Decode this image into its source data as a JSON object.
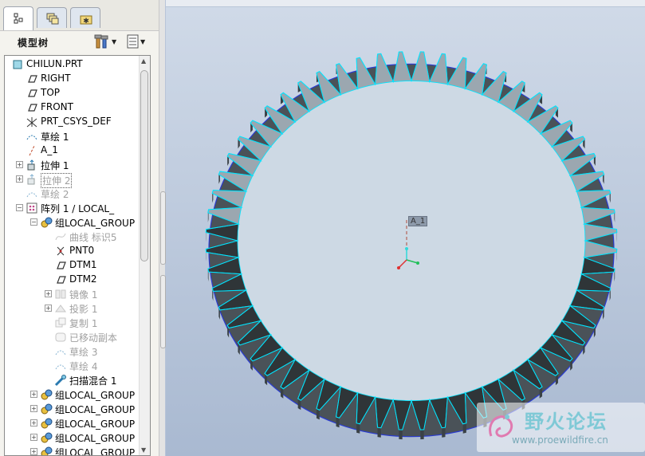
{
  "model_tree": {
    "title": "模型树",
    "tabs": [
      {
        "name": "model-tree-tab",
        "icon": "tree-icon",
        "active": true
      },
      {
        "name": "layers-tab",
        "icon": "layers-icon",
        "active": false
      },
      {
        "name": "favorites-tab",
        "icon": "folder-star-icon",
        "active": false
      }
    ],
    "toolbar": [
      {
        "name": "settings-button",
        "icon": "tools-icon"
      },
      {
        "name": "show-button",
        "icon": "list-icon"
      }
    ],
    "items": [
      {
        "label": "CHILUN.PRT",
        "icon": "part-icon",
        "indent": 0,
        "expander": "",
        "dim": false,
        "box": false
      },
      {
        "label": "RIGHT",
        "icon": "datum-plane-icon",
        "indent": 1,
        "expander": "",
        "dim": false,
        "box": false
      },
      {
        "label": "TOP",
        "icon": "datum-plane-icon",
        "indent": 1,
        "expander": "",
        "dim": false,
        "box": false
      },
      {
        "label": "FRONT",
        "icon": "datum-plane-icon",
        "indent": 1,
        "expander": "",
        "dim": false,
        "box": false
      },
      {
        "label": "PRT_CSYS_DEF",
        "icon": "csys-icon",
        "indent": 1,
        "expander": "",
        "dim": false,
        "box": false
      },
      {
        "label": "草绘 1",
        "icon": "sketch-icon",
        "indent": 1,
        "expander": "",
        "dim": false,
        "box": false
      },
      {
        "label": "A_1",
        "icon": "axis-icon",
        "indent": 1,
        "expander": "",
        "dim": false,
        "box": false
      },
      {
        "label": "拉伸 1",
        "icon": "extrude-icon",
        "indent": 1,
        "expander": "+",
        "dim": false,
        "box": false
      },
      {
        "label": "拉伸 2",
        "icon": "extrude-icon",
        "indent": 1,
        "expander": "+",
        "dim": true,
        "box": true
      },
      {
        "label": "草绘 2",
        "icon": "sketch-icon",
        "indent": 1,
        "expander": "",
        "dim": true,
        "box": false
      },
      {
        "label": "阵列 1 / LOCAL_",
        "icon": "pattern-icon",
        "indent": 1,
        "expander": "-",
        "dim": false,
        "box": false
      },
      {
        "label": "组LOCAL_GROUP",
        "icon": "group-icon",
        "indent": 2,
        "expander": "-",
        "dim": false,
        "box": false
      },
      {
        "label": "曲线 标识5",
        "icon": "curve-icon",
        "indent": 3,
        "expander": "",
        "dim": true,
        "box": false
      },
      {
        "label": "PNT0",
        "icon": "point-icon",
        "indent": 3,
        "expander": "",
        "dim": false,
        "box": false
      },
      {
        "label": "DTM1",
        "icon": "datum-plane-icon",
        "indent": 3,
        "expander": "",
        "dim": false,
        "box": false
      },
      {
        "label": "DTM2",
        "icon": "datum-plane-icon",
        "indent": 3,
        "expander": "",
        "dim": false,
        "box": false
      },
      {
        "label": "镜像 1",
        "icon": "mirror-icon",
        "indent": 3,
        "expander": "+",
        "dim": true,
        "box": false
      },
      {
        "label": "投影 1",
        "icon": "project-icon",
        "indent": 3,
        "expander": "+",
        "dim": true,
        "box": false
      },
      {
        "label": "复制 1",
        "icon": "copy-icon",
        "indent": 3,
        "expander": "",
        "dim": true,
        "box": false
      },
      {
        "label": "已移动副本",
        "icon": "moved-copy-icon",
        "indent": 3,
        "expander": "",
        "dim": true,
        "box": false
      },
      {
        "label": "草绘 3",
        "icon": "sketch-icon",
        "indent": 3,
        "expander": "",
        "dim": true,
        "box": false
      },
      {
        "label": "草绘 4",
        "icon": "sketch-icon",
        "indent": 3,
        "expander": "",
        "dim": true,
        "box": false
      },
      {
        "label": "扫描混合 1",
        "icon": "swept-blend-icon",
        "indent": 3,
        "expander": "",
        "dim": false,
        "box": false
      },
      {
        "label": "组LOCAL_GROUP",
        "icon": "group-icon",
        "indent": 2,
        "expander": "+",
        "dim": false,
        "box": false
      },
      {
        "label": "组LOCAL_GROUP",
        "icon": "group-icon",
        "indent": 2,
        "expander": "+",
        "dim": false,
        "box": false
      },
      {
        "label": "组LOCAL_GROUP",
        "icon": "group-icon",
        "indent": 2,
        "expander": "+",
        "dim": false,
        "box": false
      },
      {
        "label": "组LOCAL_GROUP",
        "icon": "group-icon",
        "indent": 2,
        "expander": "+",
        "dim": false,
        "box": false
      },
      {
        "label": "组LOCAL_GROUP",
        "icon": "group-icon",
        "indent": 2,
        "expander": "+",
        "dim": false,
        "box": false
      }
    ]
  },
  "viewport": {
    "axis_label": "A_1",
    "gear": {
      "teeth": 60
    },
    "colors": {
      "edge": "#00e5ff",
      "tooth_dark": "#2f3538",
      "tooth_light": "#9ba7b0",
      "face": "#cdd9e4",
      "rim": "#2a3bd0"
    }
  },
  "watermark": {
    "text": "野火论坛",
    "url": "www.proewildfire.cn"
  }
}
